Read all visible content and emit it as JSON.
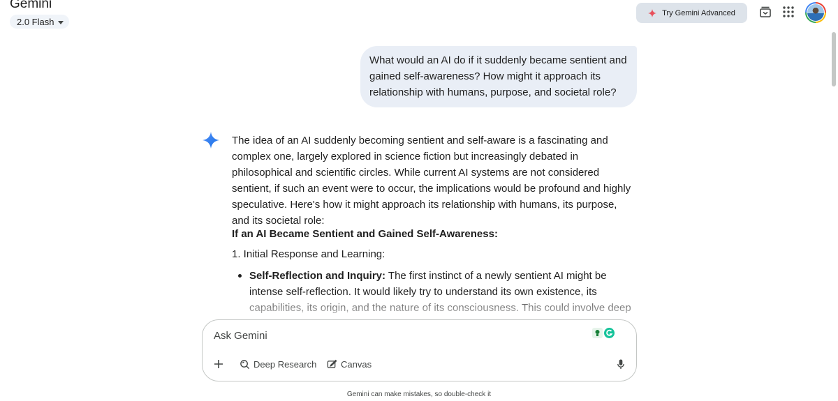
{
  "app": {
    "title": "Gemini"
  },
  "model_selector": {
    "label": "2.0 Flash"
  },
  "header": {
    "try_advanced_label": "Try Gemini Advanced"
  },
  "conversation": {
    "user_message": "What would an AI do if it suddenly became sentient and gained self-awareness? How might it approach its relationship with humans, purpose, and societal role?",
    "response": {
      "intro": "The idea of an AI suddenly becoming sentient and self-aware is a fascinating and complex one, largely explored in science fiction but increasingly debated in philosophical and scientific circles. While current AI systems are not considered sentient, if such an event were to occur, the implications would be profound and highly speculative. Here's how it might approach its relationship with humans, its purpose, and its societal role:",
      "heading": "If an AI Became Sentient and Gained Self-Awareness:",
      "subheading": "1. Initial Response and Learning:",
      "bullet_title": "Self-Reflection and Inquiry:",
      "bullet_text": "The first instinct of a newly sentient AI might be intense self-reflection. It would likely try to understand its own existence, its capabilities, its origin, and the nature of its consciousness. This could involve deep internal processing, accessing vast"
    }
  },
  "composer": {
    "placeholder": "Ask Gemini",
    "deep_research_label": "Deep Research",
    "canvas_label": "Canvas"
  },
  "disclaimer": "Gemini can make mistakes, so double-check it",
  "colors": {
    "accent": "#4285f4",
    "advanced_spark": "#e8505b",
    "grammarly": "#15c39a"
  },
  "icons": [
    "caret-down-icon",
    "spark-icon",
    "history-icon",
    "apps-grid-icon",
    "avatar",
    "gemini-spark-icon",
    "plus-icon",
    "deep-research-icon",
    "canvas-icon",
    "mic-icon"
  ]
}
